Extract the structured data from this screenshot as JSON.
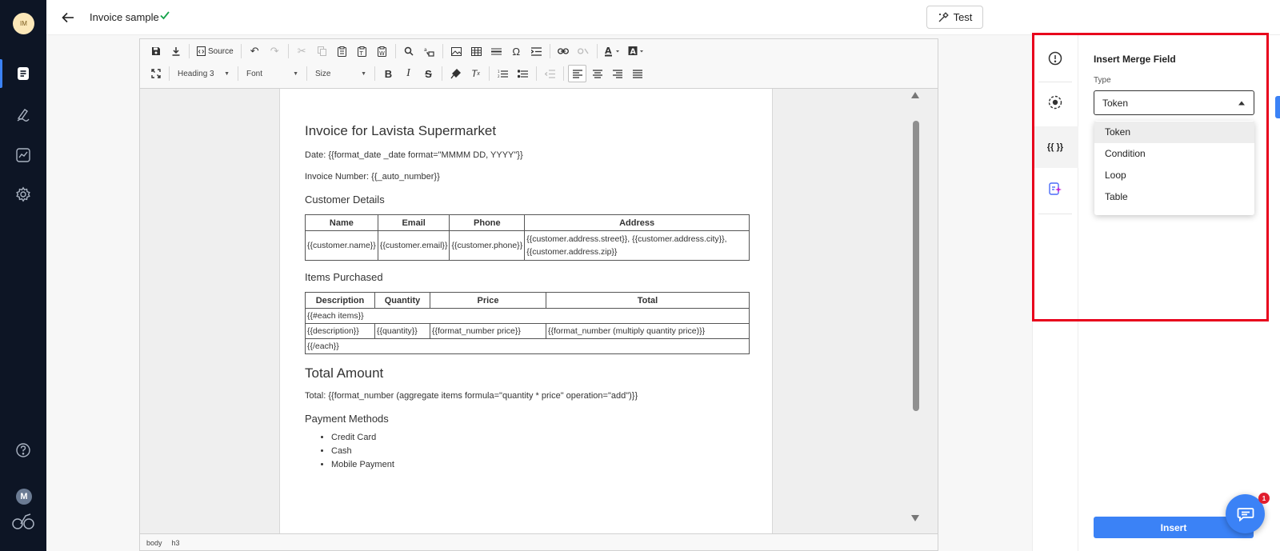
{
  "user": {
    "initials": "IM",
    "badge": "M"
  },
  "header": {
    "title": "Invoice sample",
    "test_label": "Test"
  },
  "toolbar": {
    "source_label": "Source",
    "format_combo": "Heading 3",
    "font_combo": "Font",
    "size_combo": "Size"
  },
  "document": {
    "title": "Invoice for Lavista Supermarket",
    "date_line": "Date: {{format_date _date format=\"MMMM DD, YYYY\"}}",
    "invoice_line": "Invoice Number: {{_auto_number}}",
    "customer_heading": "Customer Details",
    "customer_table": {
      "headers": [
        "Name",
        "Email",
        "Phone",
        "Address"
      ],
      "row": [
        "{{customer.name}}",
        "{{customer.email}}",
        "{{customer.phone}}",
        "{{customer.address.street}}, {{customer.address.city}}, {{customer.address.zip}}"
      ]
    },
    "items_heading": "Items Purchased",
    "items_table": {
      "headers": [
        "Description",
        "Quantity",
        "Price",
        "Total"
      ],
      "each_open": "{{#each items}}",
      "row": [
        "{{description}}",
        "{{quantity}}",
        "{{format_number price}}",
        "{{format_number (multiply quantity price)}}"
      ],
      "each_close": "{{/each}}"
    },
    "total_heading": "Total Amount",
    "total_line": "Total: {{format_number (aggregate items formula=\"quantity * price\" operation=\"add\")}}",
    "payment_heading": "Payment Methods",
    "payment_methods": [
      "Credit Card",
      "Cash",
      "Mobile Payment"
    ]
  },
  "statusbar": {
    "path": [
      "body",
      "h3"
    ]
  },
  "panel": {
    "title": "Insert Merge Field",
    "type_label": "Type",
    "type_value": "Token",
    "options": [
      "Token",
      "Condition",
      "Loop",
      "Table"
    ],
    "merge_icon_text": "{{ }}",
    "insert_label": "Insert"
  },
  "chat": {
    "badge_count": "1"
  },
  "colors": {
    "accent": "#3b82f6",
    "rail": "#0d1525",
    "highlight_box": "#e8001c",
    "success": "#16a34a"
  }
}
